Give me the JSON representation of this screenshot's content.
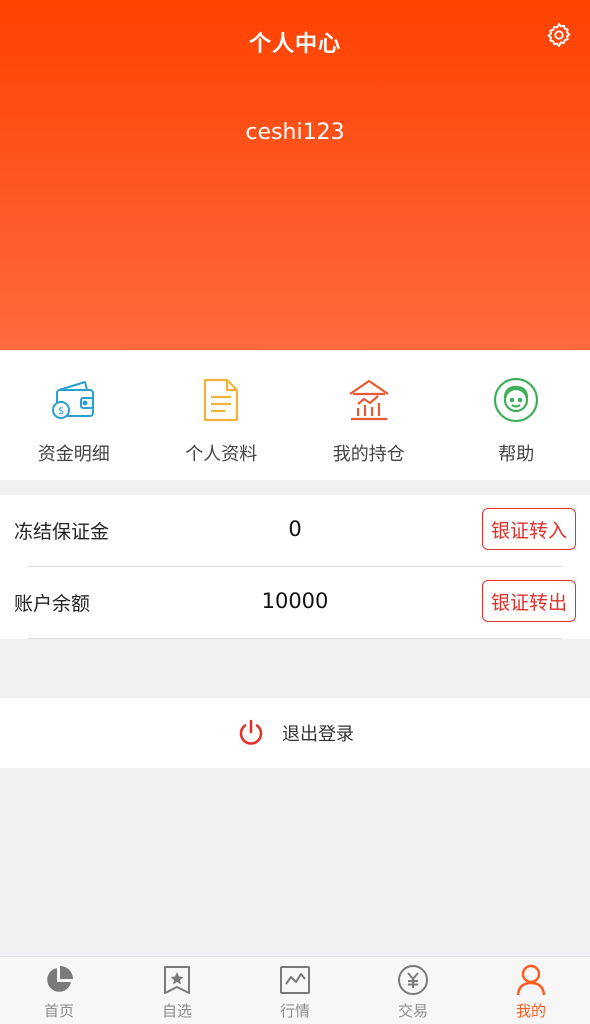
{
  "header": {
    "title": "个人中心",
    "username": "ceshi123"
  },
  "quick_menu": [
    {
      "label": "资金明细",
      "icon": "wallet-icon"
    },
    {
      "label": "个人资料",
      "icon": "document-icon"
    },
    {
      "label": "我的持仓",
      "icon": "bank-chart-icon"
    },
    {
      "label": "帮助",
      "icon": "support-agent-icon"
    }
  ],
  "info": {
    "frozen_margin": {
      "label": "冻结保证金",
      "value": "0",
      "action": "银证转入"
    },
    "balance": {
      "label": "账户余额",
      "value": "10000",
      "action": "银证转出"
    }
  },
  "logout": {
    "label": "退出登录"
  },
  "tabbar": [
    {
      "label": "首页",
      "icon": "pie-chart-icon",
      "active": false
    },
    {
      "label": "自选",
      "icon": "star-bookmark-icon",
      "active": false
    },
    {
      "label": "行情",
      "icon": "line-chart-icon",
      "active": false
    },
    {
      "label": "交易",
      "icon": "yuan-coin-icon",
      "active": false
    },
    {
      "label": "我的",
      "icon": "user-icon",
      "active": true
    }
  ],
  "colors": {
    "brand": "#ff4200",
    "accent_red": "#e0322b",
    "tab_active": "#ff5a1f"
  }
}
